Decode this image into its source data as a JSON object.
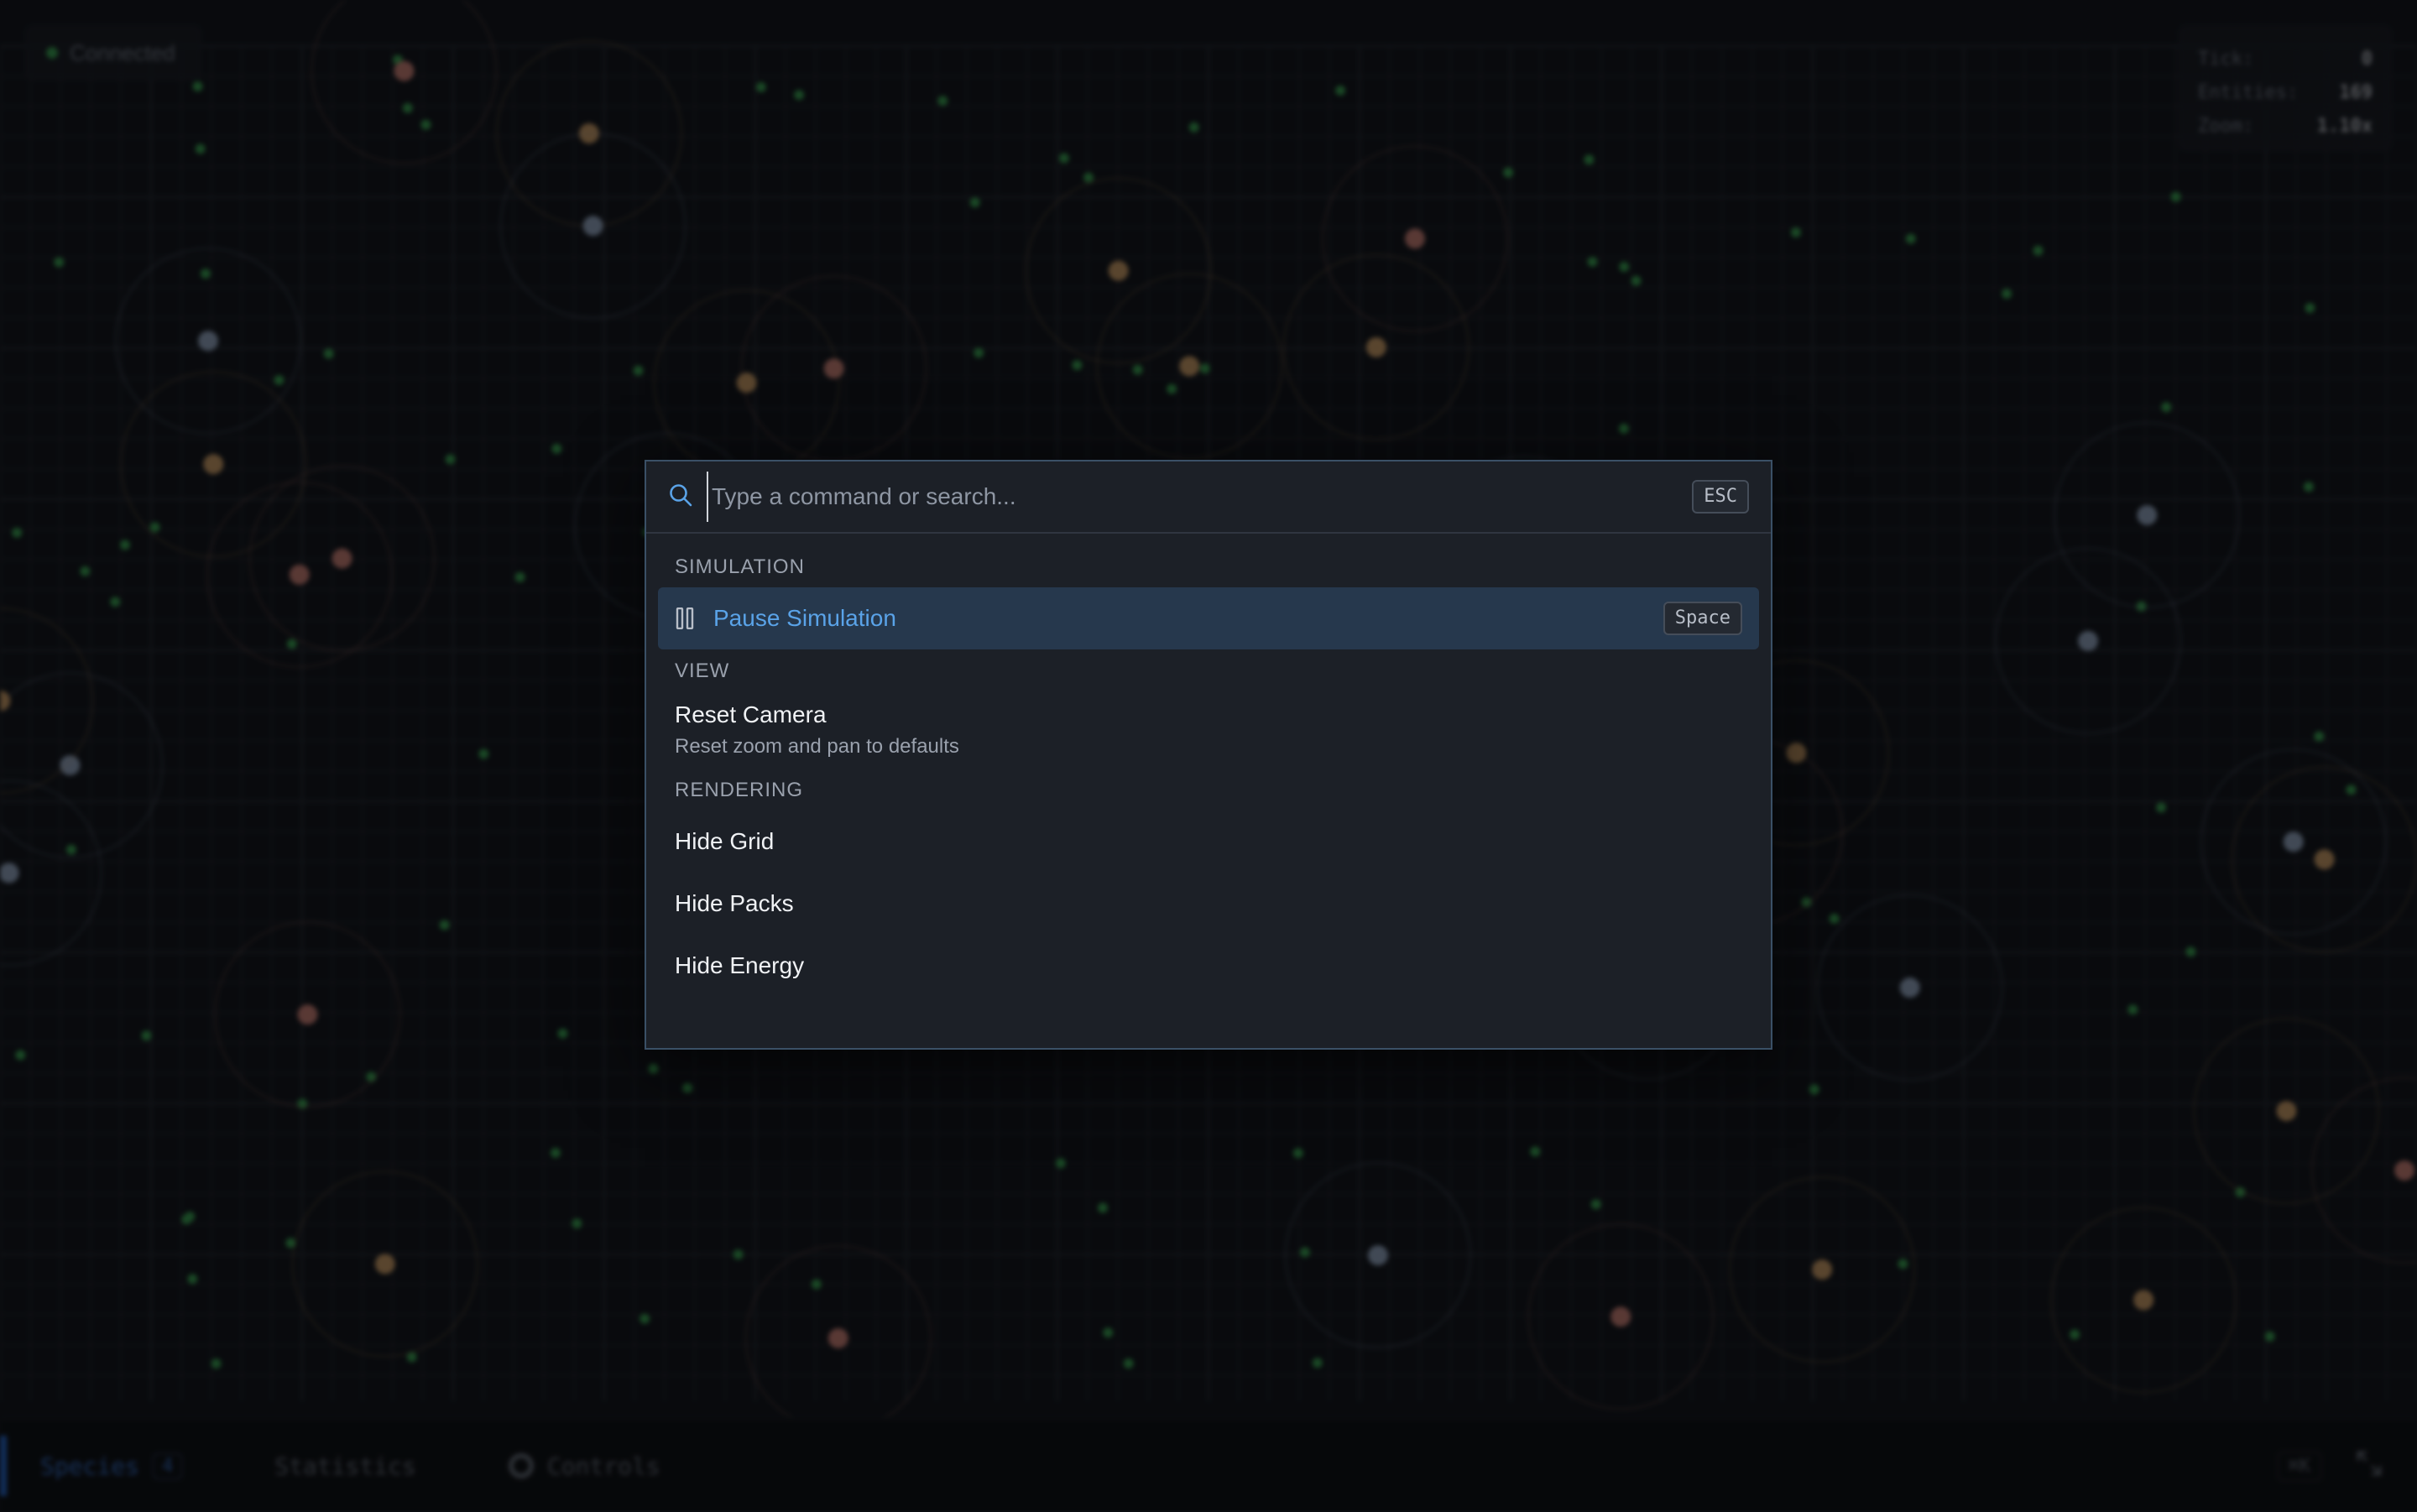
{
  "hud": {
    "connection_status": "Connected",
    "stats": [
      {
        "label": "Tick:",
        "value": "0"
      },
      {
        "label": "Entities:",
        "value": "169"
      },
      {
        "label": "Zoom:",
        "value": "1.10x"
      }
    ]
  },
  "bottom_bar": {
    "tabs": [
      {
        "label": "Species",
        "badge": "4",
        "active": true
      },
      {
        "label": "Statistics",
        "active": false
      },
      {
        "label": "Controls",
        "active": false
      }
    ],
    "right_hint": "⌘K"
  },
  "palette": {
    "search_placeholder": "Type a command or search...",
    "esc_label": "ESC",
    "groups": [
      {
        "label": "SIMULATION",
        "items": [
          {
            "title": "Pause Simulation",
            "shortcut": "Space",
            "icon": "pause-icon",
            "selected": true
          }
        ]
      },
      {
        "label": "VIEW",
        "items": [
          {
            "title": "Reset Camera",
            "description": "Reset zoom and pan to defaults"
          }
        ]
      },
      {
        "label": "RENDERING",
        "items": [
          {
            "title": "Hide Grid"
          },
          {
            "title": "Hide Packs"
          },
          {
            "title": "Hide Energy"
          }
        ]
      }
    ]
  },
  "colors": {
    "accent": "#5aa3e8",
    "selected_bg": "#26384d",
    "palette_bg": "#1c2027",
    "grid_line": "#2a2f38",
    "food": "#3fae5a"
  }
}
